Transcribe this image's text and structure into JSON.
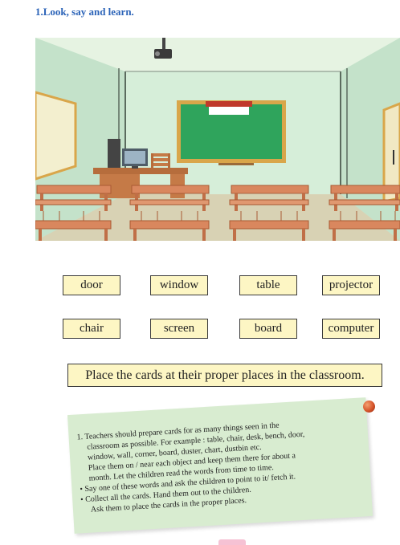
{
  "heading": "1.Look, say and learn.",
  "cards": [
    {
      "label": "door"
    },
    {
      "label": "window"
    },
    {
      "label": "table"
    },
    {
      "label": "projector"
    },
    {
      "label": "chair"
    },
    {
      "label": "screen"
    },
    {
      "label": "board"
    },
    {
      "label": "computer"
    }
  ],
  "instruction": "Place the cards at their proper places in the classroom.",
  "note": {
    "lines": [
      "1. Teachers should prepare cards for as many things seen in the",
      "classroom as possible. For example : table, chair, desk, bench, door,",
      "window, wall, corner, board, duster, chart, dustbin etc.",
      "Place them on / near each object and keep them there for about a",
      "month. Let the children read the words from time to time.",
      "• Say one of these words and ask the children to point to it/ fetch it.",
      "• Collect all the cards. Hand them out to the children.",
      "Ask them to place the cards in the proper places."
    ]
  },
  "colors": {
    "heading": "#2b63b8",
    "card_bg": "#fdf6c4",
    "note_bg": "#d8ecd0",
    "wall": "#cfe9d5",
    "board": "#2fa45c",
    "desk": "#d9875e"
  }
}
